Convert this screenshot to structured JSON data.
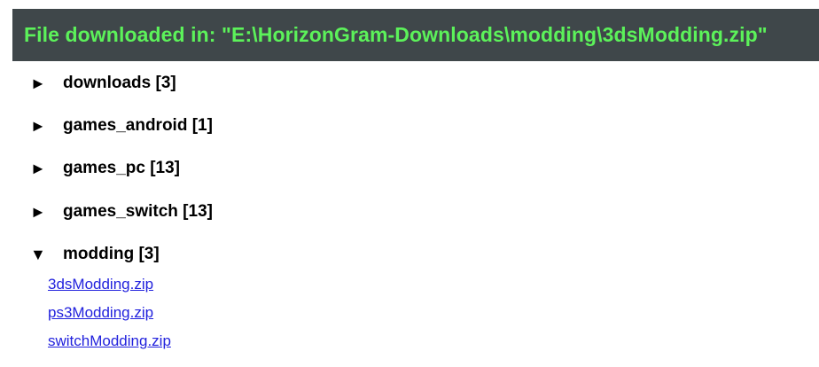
{
  "banner": {
    "text": "File downloaded in: \"E:\\HorizonGram-Downloads\\modding\\3dsModding.zip\""
  },
  "tree": {
    "collapsed_icon": "►",
    "expanded_icon": "▼",
    "folders": [
      {
        "label": "downloads [3]",
        "expanded": false
      },
      {
        "label": "games_android [1]",
        "expanded": false
      },
      {
        "label": "games_pc [13]",
        "expanded": false
      },
      {
        "label": "games_switch [13]",
        "expanded": false
      },
      {
        "label": "modding [3]",
        "expanded": true
      }
    ],
    "modding_files": [
      "3dsModding.zip",
      "ps3Modding.zip",
      "switchModding.zip"
    ]
  },
  "colors": {
    "banner_bg": "#3f474a",
    "banner_text": "#5cf25a",
    "link": "#2222dd"
  },
  "icons": {
    "collapsed": "triangle-right-icon",
    "expanded": "triangle-down-icon"
  }
}
